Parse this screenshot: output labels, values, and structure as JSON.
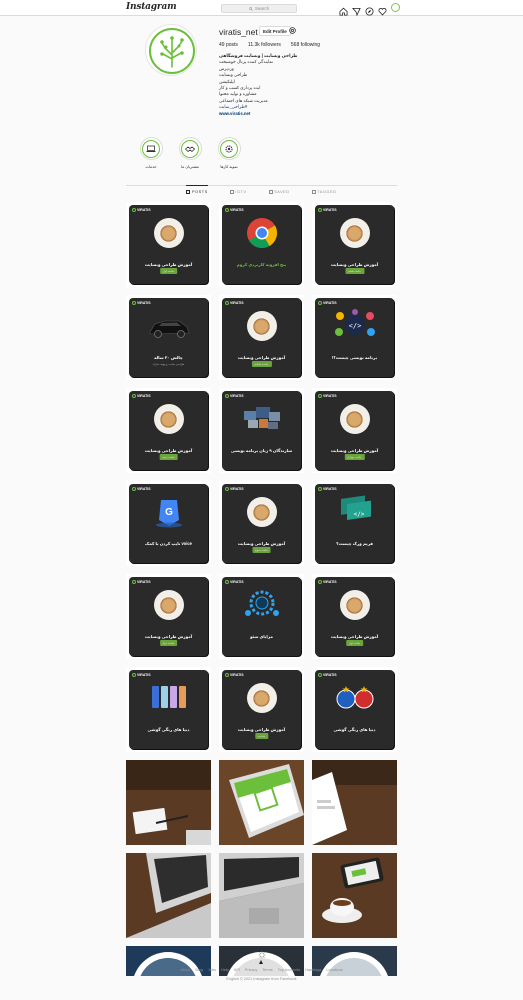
{
  "nav": {
    "logo": "Instagram",
    "search_placeholder": "Search"
  },
  "profile": {
    "username": "viratis_net",
    "edit_label": "Edit Profile",
    "posts": "49 posts",
    "followers": "11.3k followers",
    "following": "568 following",
    "bio": {
      "full_name": "طراحی وبسایت | وبسایت فروشگاهی",
      "line1": "نمایندگی کننده پرتال خوشبخت",
      "line2": "وردپرس",
      "line3": "طراحی وبسایت",
      "line4": "اپلیکیشن",
      "line5": "ایده پردازی کسب و کار",
      "line6": "مشاوره و تولید محتوا",
      "line7": "مدیریت شبکه های اجتماعی",
      "hashtag": "#طراحی_سایت",
      "link": "www.viratis.net"
    }
  },
  "highlights": [
    {
      "label": "خدمات"
    },
    {
      "label": "مشتریان ما"
    },
    {
      "label": "نمونه کارها"
    }
  ],
  "tabs": [
    {
      "label": "POSTS"
    },
    {
      "label": "IGTV"
    },
    {
      "label": "SAVED"
    },
    {
      "label": "TAGGED"
    }
  ],
  "posts": [
    {
      "brand": "VIRATIS",
      "caption": "آموزش طراحی وبسایت",
      "sub": "جلسه اول"
    },
    {
      "brand": "VIRATIS",
      "caption": "پنج افزونه کاربردی کروم",
      "sub": ""
    },
    {
      "brand": "VIRATIS",
      "caption": "آموزش طراحی وبسایت",
      "sub": "جلسه هفتم"
    },
    {
      "brand": "VIRATIS",
      "caption": "چالش ۳۰ ساله",
      "sub": "طراحی سایت و بهینه سازی"
    },
    {
      "brand": "VIRATIS",
      "caption": "آموزش طراحی وبسایت",
      "sub": "جلسه ششم"
    },
    {
      "brand": "VIRATIS",
      "caption": "برنامه نویسی چیست؟!",
      "sub": ""
    },
    {
      "brand": "VIRATIS",
      "caption": "آموزش طراحی وبسایت",
      "sub": "جلسه پنجم"
    },
    {
      "brand": "VIRATIS",
      "caption": "سازندگان ۹ زبان برنامه نویسی",
      "sub": ""
    },
    {
      "brand": "VIRATIS",
      "caption": "آموزش طراحی وبسایت",
      "sub": "جلسه چهارم"
    },
    {
      "brand": "VIRATIS",
      "caption": "voice تایپ کردن با کمک",
      "sub": ""
    },
    {
      "brand": "VIRATIS",
      "caption": "آموزش طراحی وبسایت",
      "sub": "جلسه سوم"
    },
    {
      "brand": "VIRATIS",
      "caption": "فریم ورک چیست؟",
      "sub": ""
    },
    {
      "brand": "VIRATIS",
      "caption": "آموزش طراحی وبسایت",
      "sub": "جلسه دوم"
    },
    {
      "brand": "VIRATIS",
      "caption": "مزایای سئو",
      "sub": ""
    },
    {
      "brand": "VIRATIS",
      "caption": "آموزش طراحی وبسایت",
      "sub": "جلسه اول"
    },
    {
      "brand": "VIRATIS",
      "caption": "دنیا های رنگی گوشی",
      "sub": ""
    },
    {
      "brand": "VIRATIS",
      "caption": "آموزش طراحی وبسایت",
      "sub": "مقدمه"
    },
    {
      "brand": "VIRATIS",
      "caption": "دنیا های رنگی گوشی",
      "sub": ""
    }
  ],
  "footer": {
    "links": [
      "About",
      "Blog",
      "Jobs",
      "Help",
      "API",
      "Privacy",
      "Terms",
      "Top Accounts",
      "Hashtags",
      "Locations"
    ],
    "copyright": "© 2021 Instagram from Facebook",
    "language": "English"
  },
  "colors": {
    "brand_green": "#6cbf3b",
    "card_dark": "#2a2a2a"
  }
}
